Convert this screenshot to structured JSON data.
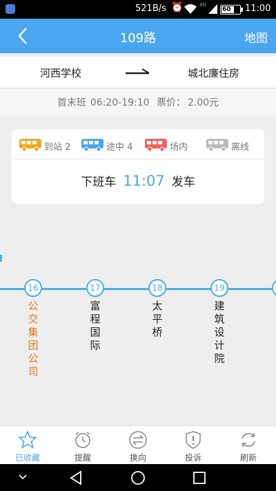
{
  "status_bar": {
    "speed": "521B/s",
    "network": "4G",
    "battery": "60",
    "time": "11:00"
  },
  "nav": {
    "title": "109路",
    "map_label": "地图"
  },
  "route": {
    "from": "河西学校",
    "to": "城北廉住房"
  },
  "info": {
    "schedule_label": "首末班",
    "schedule_time": "06:20-19:10",
    "fare_label": "票价：",
    "fare": "2.00元"
  },
  "legend": [
    {
      "label": "到站",
      "count": "2",
      "color": "#f5a623",
      "icon": "bus-arrived-icon"
    },
    {
      "label": "途中",
      "count": "4",
      "color": "#4aa6ef",
      "icon": "bus-en-route-icon"
    },
    {
      "label": "场内",
      "count": "",
      "color": "#f0605e",
      "icon": "bus-in-depot-icon"
    },
    {
      "label": "离线",
      "count": "",
      "color": "#bbbbbb",
      "icon": "bus-offline-icon"
    }
  ],
  "departure": {
    "prefix": "下班车",
    "time": "11:07",
    "suffix": "发车"
  },
  "stops": [
    {
      "number": "16",
      "name": "公交集团公司",
      "current": true
    },
    {
      "number": "17",
      "name": "富程国际",
      "current": false
    },
    {
      "number": "18",
      "name": "太平桥",
      "current": false
    },
    {
      "number": "19",
      "name": "建筑设计院",
      "current": false
    },
    {
      "number": "",
      "name": "",
      "current": false
    }
  ],
  "tabs": [
    {
      "label": "已收藏",
      "icon": "star-icon",
      "active": true
    },
    {
      "label": "提醒",
      "icon": "alarm-clock-icon",
      "active": false
    },
    {
      "label": "换向",
      "icon": "swap-direction-icon",
      "active": false
    },
    {
      "label": "投诉",
      "icon": "complaint-shield-icon",
      "active": false
    },
    {
      "label": "刷新",
      "icon": "refresh-icon",
      "active": false
    }
  ],
  "colors": {
    "primary": "#4aa6ef",
    "current_stop": "#e07a20",
    "route_line": "#4ab0e8"
  }
}
